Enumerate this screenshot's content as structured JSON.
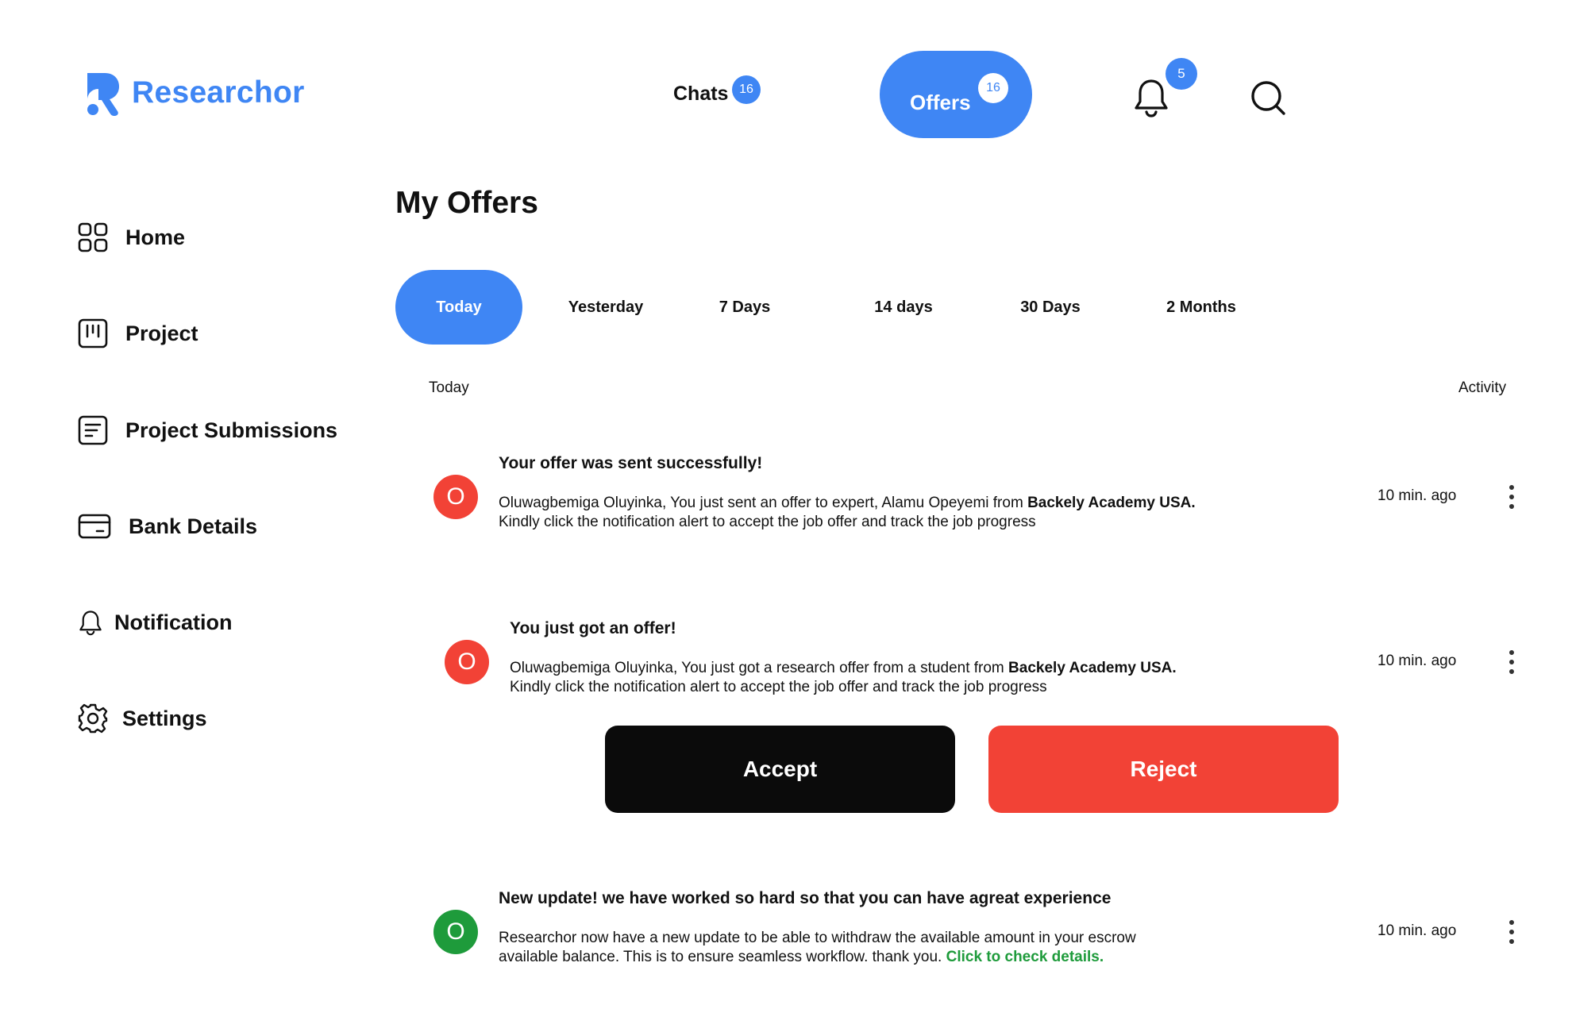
{
  "brand": {
    "name": "Researchor",
    "color": "#3F86F4"
  },
  "nav": {
    "chats_label": "Chats",
    "chats_badge": "16",
    "offers_label": "Offers",
    "offers_badge": "16",
    "notifications_badge": "5",
    "bell_icon": "bell-icon",
    "search_icon": "search-icon"
  },
  "sidebar": {
    "items": [
      {
        "label": "Home",
        "icon": "grid-icon"
      },
      {
        "label": "Project",
        "icon": "kanban-icon"
      },
      {
        "label": "Project Submissions",
        "icon": "document-icon"
      },
      {
        "label": "Bank Details",
        "icon": "card-icon"
      },
      {
        "label": "Notification",
        "icon": "bell-icon"
      },
      {
        "label": "Settings",
        "icon": "gear-icon"
      }
    ]
  },
  "main": {
    "title": "My Offers",
    "tabs": [
      {
        "label": "Today",
        "active": true
      },
      {
        "label": "Yesterday",
        "active": false
      },
      {
        "label": "7 Days",
        "active": false
      },
      {
        "label": "14 days",
        "active": false
      },
      {
        "label": "30 Days",
        "active": false
      },
      {
        "label": "2 Months",
        "active": false
      }
    ],
    "list_header": {
      "left": "Today",
      "right": "Activity"
    },
    "notifications": [
      {
        "avatar": "O",
        "avatar_color": "#F24236",
        "title": "Your offer was sent successfully!",
        "body_prefix": "Oluwagbemiga Oluyinka, You just sent an offer to expert, Alamu Opeyemi from ",
        "body_bold": "Backely Academy USA.",
        "body_line2": "Kindly click the notification alert to accept the job offer and track the job progress",
        "time": "10 min. ago"
      },
      {
        "avatar": "O",
        "avatar_color": "#F24236",
        "title": "You just got an offer!",
        "body_prefix": "Oluwagbemiga Oluyinka, You just got a research offer from a student from ",
        "body_bold": "Backely Academy USA.",
        "body_line2": "Kindly click the notification alert to accept the job offer and track the job progress",
        "time": "10 min. ago",
        "accept_label": "Accept",
        "reject_label": "Reject"
      },
      {
        "avatar": "O",
        "avatar_color": "#1E9B3B",
        "title": "New update! we have worked so hard so that you can have agreat experience",
        "body_line1": "Researchor now have a new update to be able to withdraw the available amount in your escrow",
        "body_line2_prefix": "available balance. This is to ensure seamless workflow. thank you. ",
        "link": "Click to check details.",
        "time": "10 min. ago"
      }
    ]
  },
  "colors": {
    "accent": "#3F86F4",
    "reject": "#F24236",
    "accept": "#0B0B0B",
    "success": "#1E9B3B"
  }
}
